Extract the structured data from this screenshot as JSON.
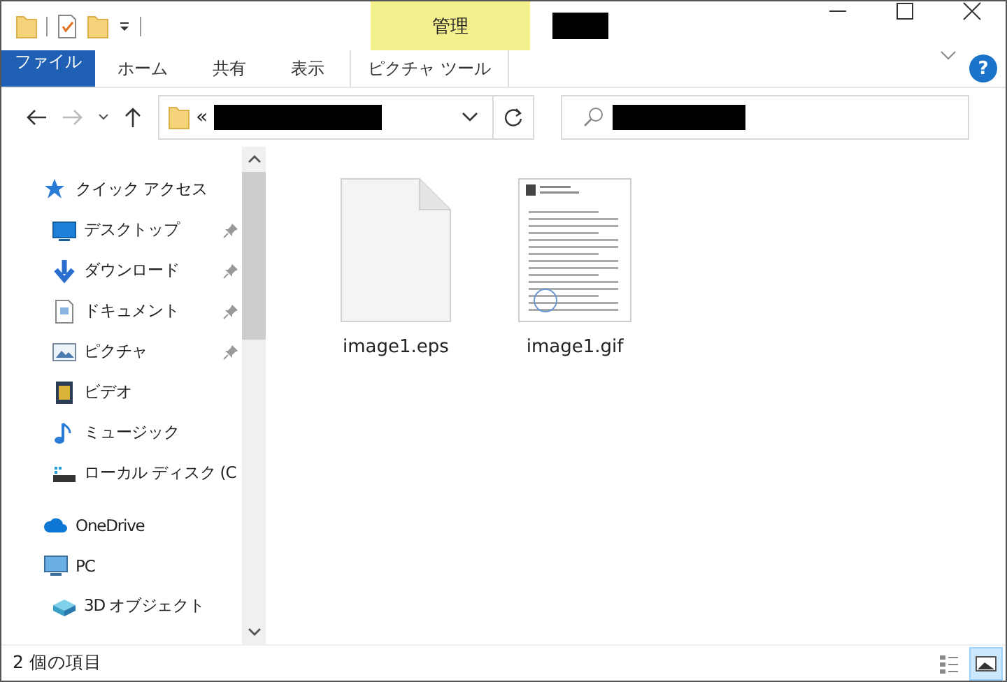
{
  "title_bar": {
    "context_tab": "管理"
  },
  "ribbon": {
    "tabs": [
      {
        "label": "ファイル",
        "selected": true,
        "kind": "file"
      },
      {
        "label": "ホーム",
        "selected": false,
        "kind": "tab"
      },
      {
        "label": "共有",
        "selected": false,
        "kind": "tab"
      },
      {
        "label": "表示",
        "selected": false,
        "kind": "tab"
      },
      {
        "label": "ピクチャ ツール",
        "selected": false,
        "kind": "context"
      }
    ],
    "help": "?"
  },
  "address_bar": {
    "prefix": "«"
  },
  "sidebar": {
    "items": [
      {
        "label": "クイック アクセス",
        "children": [
          {
            "label": "デスクトップ",
            "pinned": true
          },
          {
            "label": "ダウンロード",
            "pinned": true
          },
          {
            "label": "ドキュメント",
            "pinned": true
          },
          {
            "label": "ピクチャ",
            "pinned": true
          },
          {
            "label": "ビデオ",
            "pinned": false
          },
          {
            "label": "ミュージック",
            "pinned": false
          },
          {
            "label": "ローカル ディスク (C",
            "pinned": false
          }
        ]
      },
      {
        "label": "OneDrive"
      },
      {
        "label": "PC",
        "children": [
          {
            "label": "3D オブジェクト"
          }
        ]
      }
    ]
  },
  "files": [
    {
      "name": "image1.eps",
      "kind": "blank"
    },
    {
      "name": "image1.gif",
      "kind": "document"
    }
  ],
  "status_bar": {
    "count": "2 個の項目",
    "views": [
      {
        "selected": false,
        "kind": "details"
      },
      {
        "selected": true,
        "kind": "large"
      }
    ]
  }
}
